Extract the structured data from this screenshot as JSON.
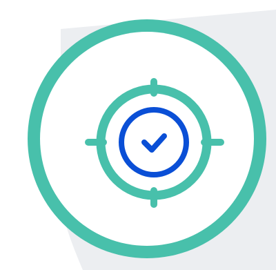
{
  "illustration": {
    "icon": "target-check-icon",
    "colors": {
      "page_background": "#ffffff",
      "background_panel": "#eceef1",
      "outer_ring": "#48c0ab",
      "inner_circle": "#ffffff",
      "crosshair": "#48c0ab",
      "check_badge": "#0a4fd6"
    }
  }
}
